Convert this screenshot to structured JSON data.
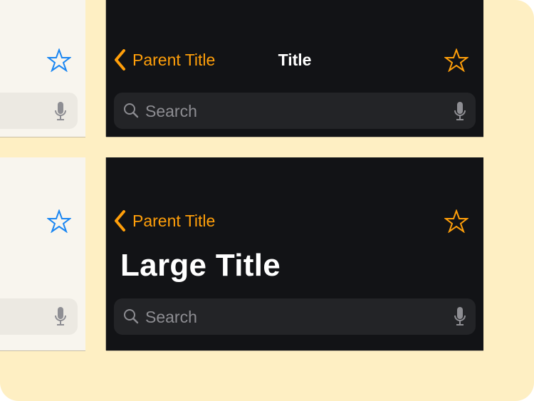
{
  "colors": {
    "canvas_bg": "#FEEFC3",
    "light_panel_bg": "#F8F5EE",
    "dark_panel_bg": "#121316",
    "light_accent": "#1A86F2",
    "dark_accent": "#FF9F0A",
    "search_placeholder": "#8D8D92"
  },
  "light_variants": [
    {
      "style": "standard-title",
      "nav": {
        "trailing_icon": "star-icon"
      },
      "search": {
        "trailing_icon": "microphone-icon"
      }
    },
    {
      "style": "large-title",
      "nav": {
        "trailing_icon": "star-icon"
      },
      "search": {
        "trailing_icon": "microphone-icon"
      }
    }
  ],
  "dark_variants": [
    {
      "style": "standard-title",
      "nav": {
        "back_icon": "chevron-left-icon",
        "back_label": "Parent Title",
        "title": "Title",
        "trailing_icon": "star-icon"
      },
      "search": {
        "leading_icon": "magnifying-glass-icon",
        "placeholder": "Search",
        "trailing_icon": "microphone-icon"
      }
    },
    {
      "style": "large-title",
      "nav": {
        "back_icon": "chevron-left-icon",
        "back_label": "Parent Title",
        "large_title": "Large Title",
        "trailing_icon": "star-icon"
      },
      "search": {
        "leading_icon": "magnifying-glass-icon",
        "placeholder": "Search",
        "trailing_icon": "microphone-icon"
      }
    }
  ]
}
